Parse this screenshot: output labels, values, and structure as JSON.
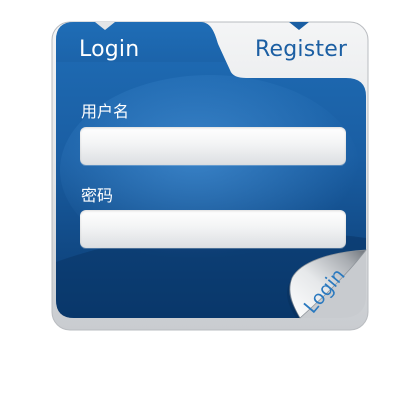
{
  "tabs": {
    "login_label": "Login",
    "register_label": "Register"
  },
  "form": {
    "username_label": "用户名",
    "username_value": "",
    "password_label": "密码",
    "password_value": ""
  },
  "corner": {
    "login_label": "Login"
  },
  "colors": {
    "panel_blue_dark": "#0b3f78",
    "panel_blue": "#1a5ea3",
    "panel_blue_light": "#3b86cc",
    "frame_gray": "#d8dadc",
    "tab_text_blue": "#1c5fa3"
  }
}
